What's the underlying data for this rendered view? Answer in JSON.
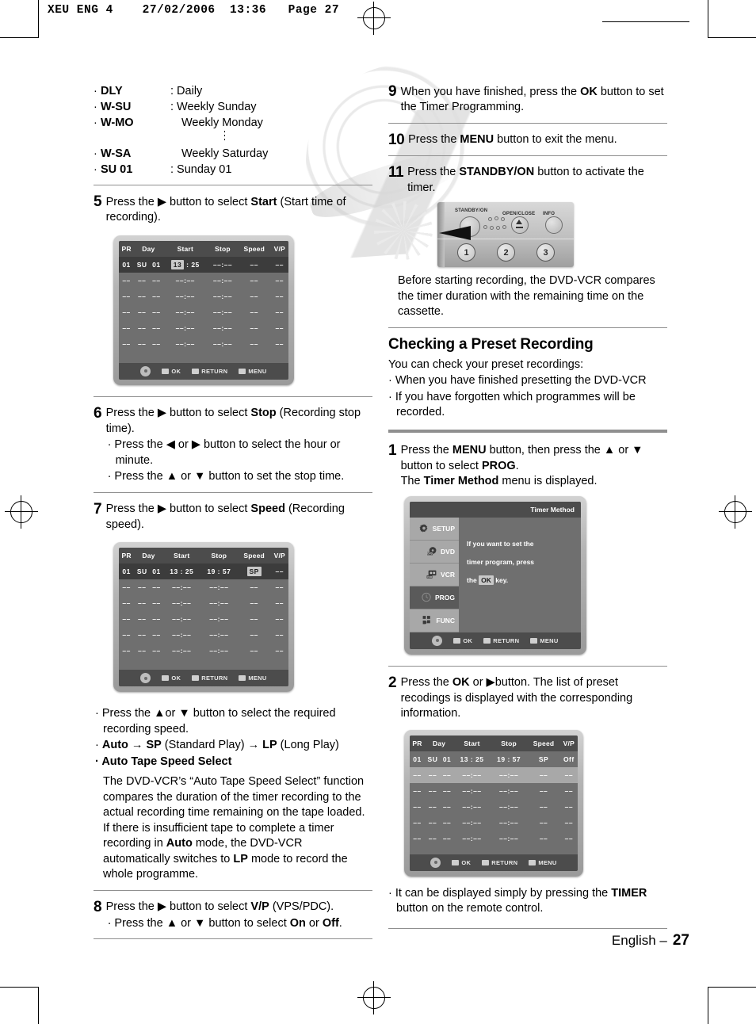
{
  "header": {
    "text": "XEU ENG 4    27/02/2006  13:36   Page 27"
  },
  "footer": {
    "language": "English  –",
    "page_number": "27"
  },
  "left_column": {
    "day_definitions": [
      {
        "term": "DLY",
        "desc": ": Daily"
      },
      {
        "term": "W-SU",
        "desc": ": Weekly Sunday"
      },
      {
        "term": "W-MO",
        "desc": "Weekly Monday"
      },
      {
        "term": "W-SA",
        "desc": "Weekly Saturday"
      },
      {
        "term": "SU 01",
        "desc": ": Sunday 01"
      }
    ],
    "step5": {
      "num": "5",
      "line1_a": "Press the ",
      "line1_arrow": "▶",
      "line1_b": " button to select ",
      "line1_bold": "Start",
      "line1_c": " (Start time of recording)."
    },
    "step6": {
      "num": "6",
      "text_a": "Press the ",
      "arrow": "▶",
      "text_b": " button to select ",
      "bold": "Stop",
      "text_c": " (Recording stop time).",
      "sub1": "· Press the ◀ or ▶ button to select the hour or minute.",
      "sub2": "· Press the ▲ or ▼ button to set the stop time."
    },
    "step7": {
      "num": "7",
      "text_a": "Press the ",
      "arrow": "▶",
      "text_b": " button to select ",
      "bold": "Speed",
      "text_c": " (Recording speed).",
      "sub1": "· Press the ▲or ▼ button to select the required recording speed.",
      "sub2_parts": {
        "bullet": "· ",
        "auto": "Auto",
        "arrow1": " → ",
        "sp": "SP",
        "sp_exp": " (Standard Play)",
        "arrow2": " → ",
        "lp": "LP",
        "lp_exp": " (Long Play)"
      },
      "sub3": "· Auto Tape Speed Select",
      "para": "The DVD-VCR’s “Auto Tape Speed Select” function compares the duration of the timer recording to the actual recording time remaining on the tape loaded. If there is insufficient tape to complete a timer recording in ",
      "para_bold1": "Auto",
      "para_mid": " mode, the DVD-VCR automatically switches to ",
      "para_bold2": "LP",
      "para_end": " mode to record the whole programme."
    },
    "step8": {
      "num": "8",
      "text_a": "Press the ",
      "arrow": "▶",
      "text_b": " button to select ",
      "bold": "V/P",
      "text_c": " (VPS/PDC).",
      "sub1_a": "· Press the ▲ or ▼ button to select ",
      "sub1_on": "On",
      "sub1_b": " or ",
      "sub1_off": "Off",
      "sub1_c": "."
    }
  },
  "right_column": {
    "step9": {
      "num": "9",
      "text_a": "When you have finished, press the ",
      "bold": "OK",
      "text_b": " button to set the Timer Programming."
    },
    "step10": {
      "num": "10",
      "text_a": "Press the ",
      "bold": "MENU",
      "text_b": " button to exit the menu."
    },
    "step11": {
      "num": "11",
      "text_a": "Press the ",
      "bold": "STANDBY/ON",
      "text_b": " button to activate the timer.",
      "note": "Before starting recording, the DVD-VCR compares the timer duration with the remaining time on the cassette."
    },
    "section": {
      "heading": "Checking a Preset Recording",
      "intro": "You can check your preset recordings:",
      "bullets": [
        "· When you have finished presetting the DVD-VCR",
        "· If you have forgotten which programmes will be recorded."
      ]
    },
    "step1": {
      "num": "1",
      "text_a": "Press the ",
      "bold1": "MENU",
      "text_b": " button, then press the ▲ or ▼ button to select ",
      "bold2": "PROG",
      "text_c": ".",
      "line2_a": "The ",
      "line2_bold": "Timer Method",
      "line2_b": " menu is displayed."
    },
    "step2": {
      "num": "2",
      "text_a": "Press the ",
      "bold": "OK",
      "text_b": " or ▶button. The list of preset recodings is displayed with the corresponding information.",
      "note": "· It can be displayed simply by pressing the ",
      "note_bold": "TIMER",
      "note_end": " button on the remote control."
    }
  },
  "osd_common": {
    "columns": [
      "PR",
      "Day",
      "Start",
      "Stop",
      "Speed",
      "V/P"
    ],
    "footer_items": [
      {
        "icon": "dpad-icon",
        "label": ""
      },
      {
        "icon": "ok-key-icon",
        "label": "OK"
      },
      {
        "icon": "return-key-icon",
        "label": "RETURN"
      },
      {
        "icon": "menu-key-icon",
        "label": "MENU"
      }
    ],
    "empty_cells": [
      "––",
      "––",
      "––",
      "––:––",
      "––:––",
      "––",
      "––"
    ]
  },
  "osd_timer_start": {
    "active_row": {
      "pr": "01",
      "day": "SU",
      "daynum": "01",
      "start_hour": "13",
      "start_min": "25",
      "stop": "––:––",
      "speed": "––",
      "vp": "––"
    },
    "selected_field": "start_hour",
    "empty_rows": 5
  },
  "osd_timer_speed": {
    "active_row": {
      "pr": "01",
      "day": "SU",
      "daynum": "01",
      "start": "13 : 25",
      "stop": "19 : 57",
      "speed": "SP",
      "vp": "––"
    },
    "selected_field": "speed",
    "empty_rows": 5
  },
  "osd_timer_list": {
    "active_row": {
      "pr": "01",
      "day": "SU",
      "daynum": "01",
      "start": "13 : 25",
      "stop": "19 : 57",
      "speed": "SP",
      "vp": "Off"
    },
    "highlight_row_index": 1,
    "empty_rows": 5
  },
  "osd_timer_method": {
    "title": "Timer Method",
    "menu": [
      {
        "label": "SETUP",
        "icon": "gear-icon",
        "selected": false
      },
      {
        "label": "DVD",
        "icon": "disc-icon",
        "selected": false
      },
      {
        "label": "VCR",
        "icon": "cassette-icon",
        "selected": false
      },
      {
        "label": "PROG",
        "icon": "clock-icon",
        "selected": true
      },
      {
        "label": "FUNC",
        "icon": "blocks-icon",
        "selected": false
      }
    ],
    "message_lines": [
      "If you want to set the",
      "timer program, press",
      "the ",
      " key."
    ],
    "message_key": "OK"
  },
  "front_panel": {
    "labels": [
      "STANDBY/ON",
      "OPEN/CLOSE",
      "INFO"
    ],
    "numbers": [
      "1",
      "2",
      "3"
    ]
  }
}
